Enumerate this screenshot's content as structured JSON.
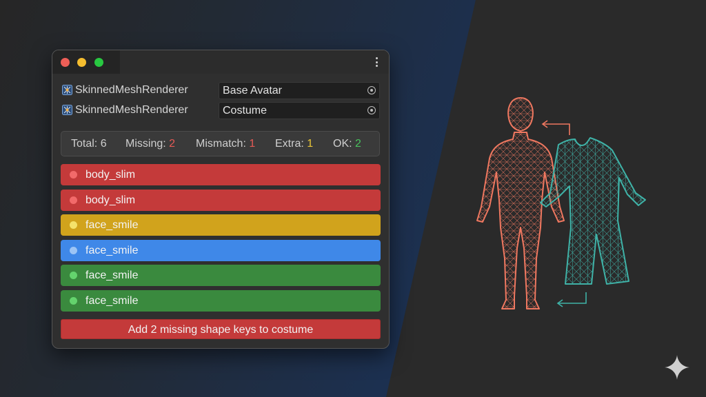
{
  "window": {
    "fields": [
      {
        "component": "SkinnedMeshRenderer",
        "value": "Base Avatar",
        "icon": "skinned-mesh-icon"
      },
      {
        "component": "SkinnedMeshRenderer",
        "value": "Costume",
        "icon": "skinned-mesh-icon"
      }
    ],
    "summary": {
      "total_label": "Total:",
      "total_value": "6",
      "missing_label": "Missing:",
      "missing_value": "2",
      "mismatch_label": "Mismatch:",
      "mismatch_value": "1",
      "extra_label": "Extra:",
      "extra_value": "1",
      "ok_label": "OK:",
      "ok_value": "2"
    },
    "rows": [
      {
        "name": "body_slim",
        "status": "missing",
        "bg": "#c43a3a",
        "dot": "#f26a6a"
      },
      {
        "name": "body_slim",
        "status": "missing",
        "bg": "#c43a3a",
        "dot": "#f26a6a"
      },
      {
        "name": "face_smile",
        "status": "extra",
        "bg": "#d1a31c",
        "dot": "#f4e26a"
      },
      {
        "name": "face_smile",
        "status": "mismatch",
        "bg": "#3f88e8",
        "dot": "#9cc4f5"
      },
      {
        "name": "face_smile",
        "status": "ok",
        "bg": "#3a8a3e",
        "dot": "#64d36d"
      },
      {
        "name": "face_smile",
        "status": "ok",
        "bg": "#3a8a3e",
        "dot": "#64d36d"
      }
    ],
    "action_label": "Add 2 missing shape keys to costume"
  },
  "colors": {
    "missing": "#e65a55",
    "extra": "#e9c638",
    "mismatch": "#3f88e8",
    "ok": "#49c25d",
    "avatar_wireframe": "#f07860",
    "costume_wireframe": "#3fb3a8"
  }
}
